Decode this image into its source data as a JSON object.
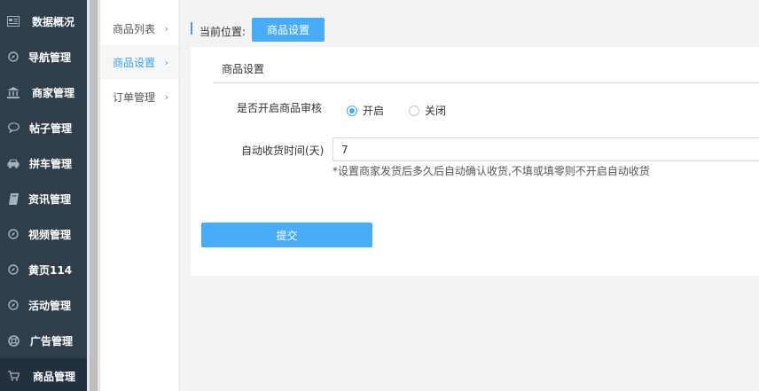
{
  "sidebar": {
    "items": [
      {
        "label": "数据概况",
        "icon": "dashboard-icon"
      },
      {
        "label": "导航管理",
        "icon": "compass-icon"
      },
      {
        "label": "商家管理",
        "icon": "bank-icon"
      },
      {
        "label": "帖子管理",
        "icon": "chat-bubble-icon"
      },
      {
        "label": "拼车管理",
        "icon": "car-icon"
      },
      {
        "label": "资讯管理",
        "icon": "book-icon"
      },
      {
        "label": "视频管理",
        "icon": "compass-icon"
      },
      {
        "label": "黄页114",
        "icon": "compass-icon"
      },
      {
        "label": "活动管理",
        "icon": "compass-icon"
      },
      {
        "label": "广告管理",
        "icon": "lifebuoy-icon"
      },
      {
        "label": "商品管理",
        "icon": "cart-icon"
      }
    ],
    "active_index": 10
  },
  "submenu": {
    "items": [
      {
        "label": "商品列表",
        "chevron": "›"
      },
      {
        "label": "商品设置",
        "chevron": "›"
      },
      {
        "label": "订单管理",
        "chevron": "›"
      }
    ],
    "active_index": 1
  },
  "breadcrumb": {
    "label": "当前位置:",
    "current": "商品设置"
  },
  "form": {
    "title": "商品设置",
    "review": {
      "label": "是否开启商品审核",
      "options": [
        "开启",
        "关闭"
      ],
      "selected": "开启"
    },
    "auto_receive": {
      "label": "自动收货时间(天)",
      "value": "7",
      "hint": "*设置商家发货后多久后自动确认收货,不填或填零则不开启自动收货"
    },
    "submit_label": "提交"
  },
  "colors": {
    "sidebar_bg": "#2f3e4b",
    "accent": "#48adf6",
    "active_link": "#3aa3e8"
  }
}
